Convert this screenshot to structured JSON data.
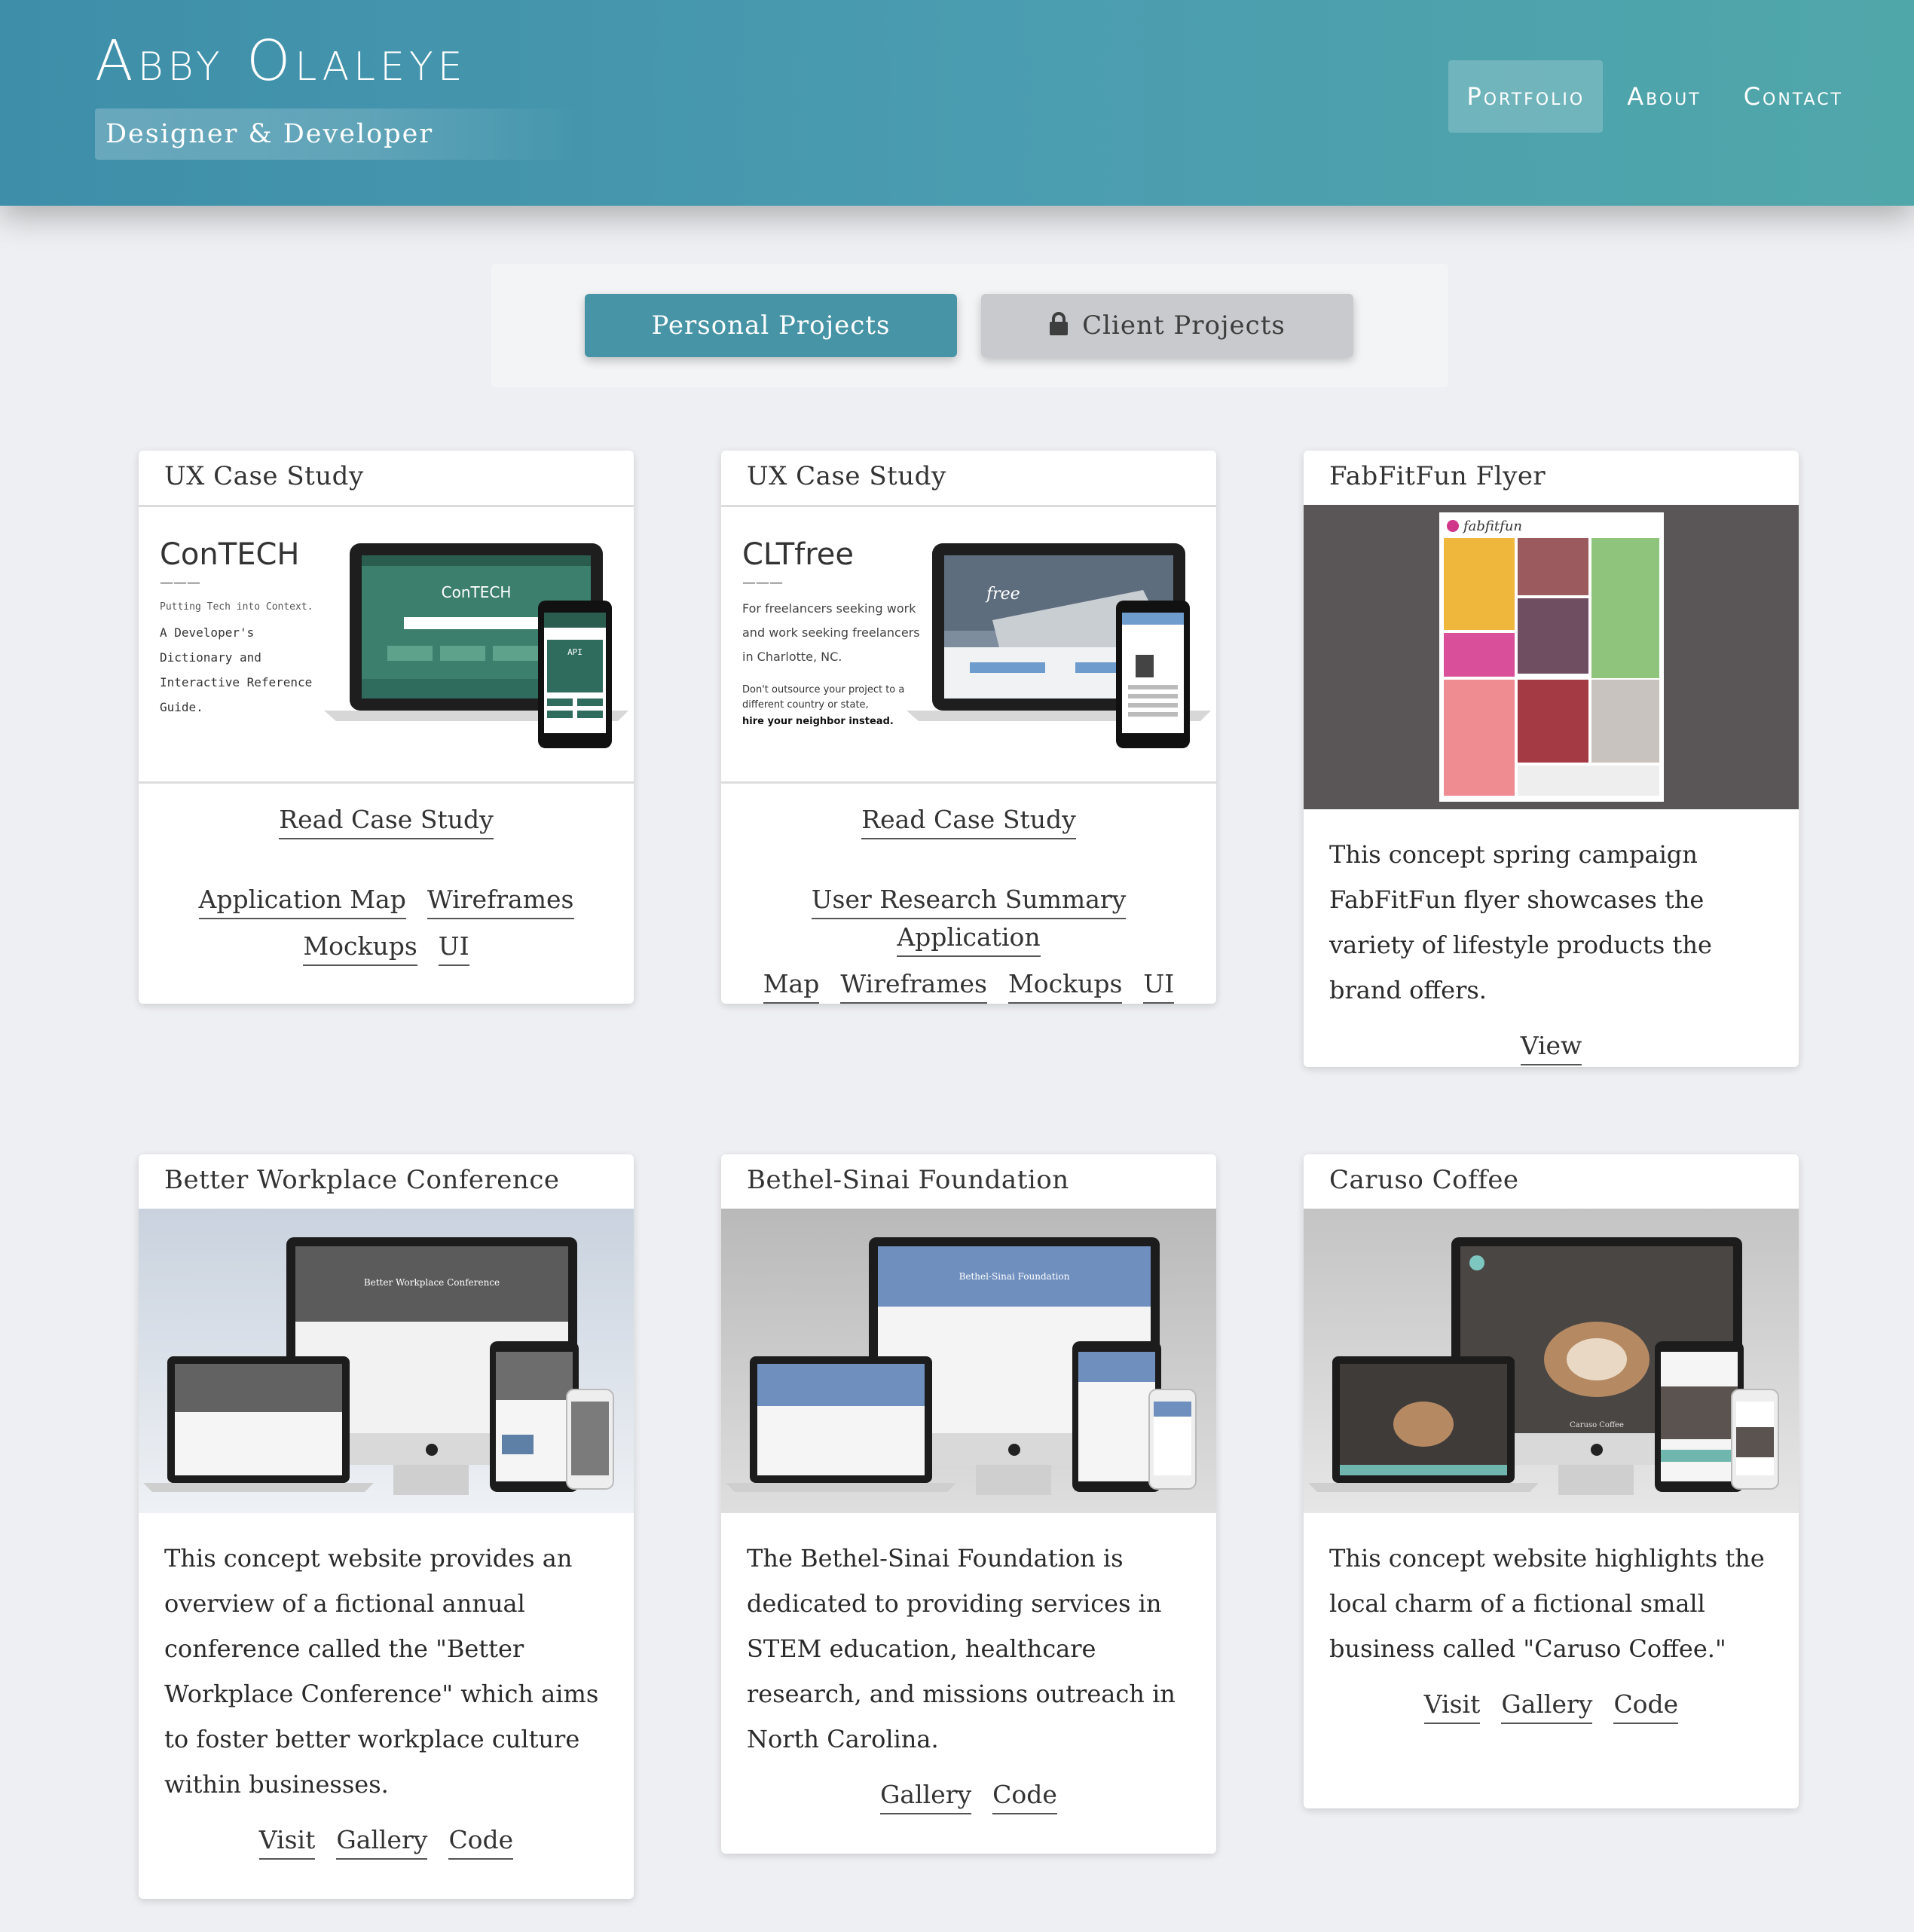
{
  "header": {
    "brand_name": "Abby Olaleye",
    "tagline": "Designer & Developer",
    "nav": [
      {
        "label": "Portfolio",
        "active": true
      },
      {
        "label": "About",
        "active": false
      },
      {
        "label": "Contact",
        "active": false
      }
    ]
  },
  "toggle": {
    "personal_label": "Personal Projects",
    "client_label": "Client Projects",
    "client_icon": "lock-icon"
  },
  "colors": {
    "header_start": "#3e8ea9",
    "header_end": "#50a7a9",
    "accent": "#4694a6",
    "page_bg": "#eeeff2",
    "card_bg": "#ffffff"
  },
  "cards": [
    {
      "title": "UX Case Study",
      "image": {
        "name": "ConTECH",
        "dashes": "———",
        "subtitle": "Putting Tech into Context.",
        "desc": [
          "A Developer's",
          "Dictionary and",
          "Interactive Reference",
          "Guide."
        ],
        "screen_title": "ConTECH",
        "phone_title": "API"
      },
      "primary_link": "Read Case Study",
      "links": [
        "Application Map",
        "Wireframes",
        "Mockups",
        "UI"
      ]
    },
    {
      "title": "UX Case Study",
      "image": {
        "name": "CLTfree",
        "dashes": "———",
        "desc": [
          "For freelancers seeking work",
          "and work seeking freelancers",
          "in Charlotte, NC."
        ],
        "note": [
          "Don't outsource your project to a",
          "different country or state,"
        ],
        "note_bold": "hire your neighbor instead.",
        "screen_title": "free"
      },
      "primary_link": "Read Case Study",
      "links": [
        "User Research Summary",
        "Application",
        "Map",
        "Wireframes",
        "Mockups",
        "UI"
      ]
    },
    {
      "title": "FabFitFun Flyer",
      "image": {
        "brand": "fabfitfun"
      },
      "description": "This concept spring campaign FabFitFun flyer showcases the variety of lifestyle products the brand offers.",
      "links": [
        "View"
      ]
    },
    {
      "title": "Better Workplace Conference",
      "image": {
        "screen_title": "Better Workplace Conference"
      },
      "description": "This concept website provides an overview of a fictional annual conference called the \"Better Workplace Conference\" which aims to foster better workplace culture within businesses.",
      "links": [
        "Visit",
        "Gallery",
        "Code"
      ]
    },
    {
      "title": "Bethel-Sinai Foundation",
      "image": {
        "screen_title": "Bethel-Sinai Foundation"
      },
      "description": "The Bethel-Sinai Foundation is dedicated to providing services in STEM education, healthcare research, and missions outreach in North Carolina.",
      "links": [
        "Gallery",
        "Code"
      ]
    },
    {
      "title": "Caruso Coffee",
      "image": {
        "screen_title": "Caruso Coffee"
      },
      "description": "This concept website highlights the local charm of a fictional small business called \"Caruso Coffee.\"",
      "links": [
        "Visit",
        "Gallery",
        "Code"
      ]
    }
  ]
}
